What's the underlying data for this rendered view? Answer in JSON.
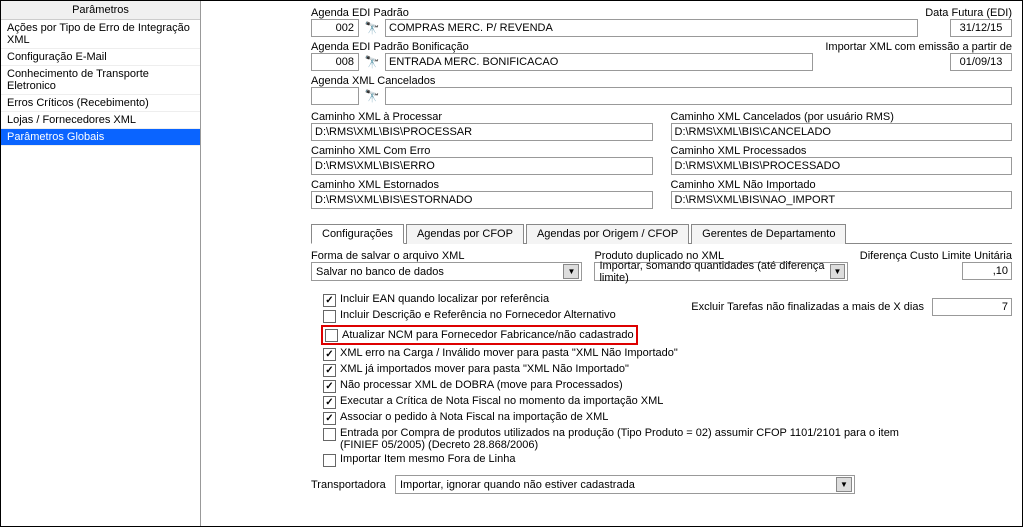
{
  "sidebar": {
    "header": "Parâmetros",
    "items": [
      {
        "label": "Ações por Tipo de Erro de Integração XML"
      },
      {
        "label": "Configuração E-Mail"
      },
      {
        "label": "Conhecimento de Transporte Eletronico"
      },
      {
        "label": "Erros Críticos (Recebimento)"
      },
      {
        "label": "Lojas / Fornecedores XML"
      },
      {
        "label": "Parâmetros Globais"
      }
    ]
  },
  "agenda": {
    "padrao_label": "Agenda EDI Padrão",
    "padrao_code": "002",
    "padrao_desc": "COMPRAS MERC. P/ REVENDA",
    "data_futura_label": "Data Futura (EDI)",
    "data_futura_value": "31/12/15",
    "bonif_label": "Agenda EDI Padrão Bonificação",
    "bonif_code": "008",
    "bonif_desc": "ENTRADA MERC. BONIFICACAO",
    "import_label": "Importar XML com emissão a partir de",
    "import_value": "01/09/13",
    "cancel_label": "Agenda XML Cancelados"
  },
  "paths": {
    "processar_label": "Caminho XML à Processar",
    "processar_value": "D:\\RMS\\XML\\BIS\\PROCESSAR",
    "cancelados_label": "Caminho XML Cancelados (por usuário RMS)",
    "cancelados_value": "D:\\RMS\\XML\\BIS\\CANCELADO",
    "erro_label": "Caminho XML Com Erro",
    "erro_value": "D:\\RMS\\XML\\BIS\\ERRO",
    "processados_label": "Caminho XML Processados",
    "processados_value": "D:\\RMS\\XML\\BIS\\PROCESSADO",
    "estornados_label": "Caminho XML Estornados",
    "estornados_value": "D:\\RMS\\XML\\BIS\\ESTORNADO",
    "nao_import_label": "Caminho XML Não Importado",
    "nao_import_value": "D:\\RMS\\XML\\BIS\\NAO_IMPORT"
  },
  "tabs": {
    "config": "Configurações",
    "cfop": "Agendas por CFOP",
    "origem": "Agendas por Origem / CFOP",
    "gerentes": "Gerentes de Departamento"
  },
  "config": {
    "forma_label": "Forma de salvar o arquivo XML",
    "forma_value": "Salvar no banco de dados",
    "dup_label": "Produto duplicado no XML",
    "dup_value": "Importar, somando quantidades (até diferença limite)",
    "dif_label": "Diferença Custo Limite Unitária",
    "dif_value": ",10",
    "excluir_label": "Excluir Tarefas não finalizadas a mais de X dias",
    "excluir_value": "7",
    "chk_ean": "Incluir EAN quando localizar por referência",
    "chk_desc": "Incluir Descrição e Referência no Fornecedor Alternativo",
    "chk_ncm": "Atualizar NCM para Fornecedor Fabricance/não cadastrado",
    "chk_carga": "XML erro na Carga / Inválido mover para pasta \"XML Não Importado\"",
    "chk_ja": "XML já importados mover para pasta \"XML Não Importado\"",
    "chk_dobra": "Não processar XML de DOBRA (move para Processados)",
    "chk_critica": "Executar a Crítica de Nota Fiscal no momento da importação XML",
    "chk_pedido": "Associar o pedido à Nota Fiscal na importação de XML",
    "chk_compra": "Entrada por Compra de produtos utilizados na produção (Tipo Produto = 02) assumir CFOP 1101/2101 para o item (FINIEF 05/2005) (Decreto 28.868/2006)",
    "chk_fora": "Importar Item mesmo Fora de Linha",
    "transp_label": "Transportadora",
    "transp_value": "Importar, ignorar quando não estiver cadastrada"
  }
}
